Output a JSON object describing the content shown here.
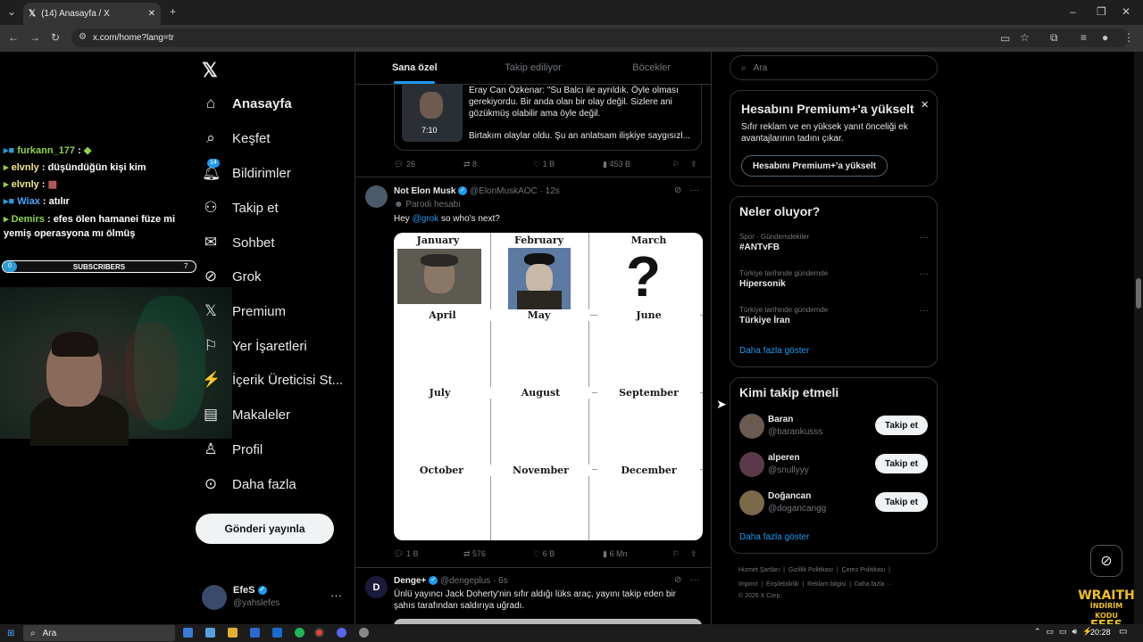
{
  "browser": {
    "tab_title": "(14) Anasayfa / X",
    "url": "x.com/home?lang=tr"
  },
  "stream": {
    "chat": [
      {
        "user": "furkann_177",
        "message": ""
      },
      {
        "user": "elvnly",
        "message": "düşündüğün kişi kim"
      },
      {
        "user": "elvnly",
        "message": ""
      },
      {
        "user": "Wiax",
        "message": "atılır"
      },
      {
        "user": "Demirs",
        "message": "efes ölen hamanei füze mi yemiş operasyona mı ölmüş"
      }
    ],
    "subscribers_label": "SUBSCRIBERS",
    "subscribers_count": "7",
    "subscribers_progress": "0",
    "overlay_text": [
      "WRAITH",
      "İNDİRİM KODU",
      "EFES"
    ]
  },
  "nav": {
    "items": [
      {
        "label": "Anasayfa",
        "icon": "home-icon",
        "badge": ""
      },
      {
        "label": "Keşfet",
        "icon": "search-icon",
        "badge": ""
      },
      {
        "label": "Bildirimler",
        "icon": "bell-icon",
        "badge": "14"
      },
      {
        "label": "Takip et",
        "icon": "follow-icon",
        "badge": ""
      },
      {
        "label": "Sohbet",
        "icon": "mail-icon",
        "badge": ""
      },
      {
        "label": "Grok",
        "icon": "grok-icon",
        "badge": ""
      },
      {
        "label": "Premium",
        "icon": "x-icon",
        "badge": ""
      },
      {
        "label": "Yer İşaretleri",
        "icon": "bookmark-icon",
        "badge": ""
      },
      {
        "label": "İçerik Üreticisi St...",
        "icon": "creator-icon",
        "badge": ""
      },
      {
        "label": "Makaleler",
        "icon": "article-icon",
        "badge": ""
      },
      {
        "label": "Profil",
        "icon": "person-icon",
        "badge": ""
      },
      {
        "label": "Daha fazla",
        "icon": "more-icon",
        "badge": ""
      }
    ],
    "post_button": "Gönderi yayınla",
    "account": {
      "name": "EfeS",
      "handle": "@yahslefes"
    }
  },
  "timeline": {
    "tabs": [
      "Sana özel",
      "Takip ediliyor",
      "Böcekler"
    ],
    "tweet1": {
      "video_duration": "7:10",
      "card_text": "Eray Can Özkenar: \"Su Balcı ile ayrıldık. Öyle olması gerekiyordu. Bir anda olan bir olay değil. Sizlere ani gözükmüş olabilir ama öyle değil.",
      "card_text2": "Birtakım olaylar oldu. Şu an anlatsam ilişkiye saygısızl...",
      "replies": "26",
      "retweets": "8",
      "likes": "1 B",
      "views": "453 B"
    },
    "tweet2": {
      "name": "Not Elon Musk",
      "handle": "@ElonMuskAOC",
      "time": "· 12s",
      "label": "Parodi hesabı",
      "text_prefix": "Hey",
      "mention": "@grok",
      "text_suffix": "so who's next?",
      "months": [
        "January",
        "February",
        "March",
        "April",
        "May",
        "June",
        "July",
        "August",
        "September",
        "October",
        "November",
        "December"
      ],
      "question_mark": "?",
      "replies": "1 B",
      "retweets": "576",
      "likes": "6 B",
      "views": "6 Mn"
    },
    "tweet3": {
      "name": "Denge+",
      "handle": "@dengeplus",
      "time": "· 6s",
      "text": "Ünlü yayıncı Jack Doherty'nin sıfır aldığı lüks araç, yayını takip eden bir şahıs tarafından saldırıya uğradı."
    }
  },
  "sidebar": {
    "search_placeholder": "Ara",
    "premium": {
      "title": "Hesabını Premium+'a yükselt",
      "text": "Sıfır reklam ve en yüksek yanıt önceliği ek avantajlarının tadını çıkar.",
      "button": "Hesabını Premium+'a yükselt"
    },
    "trends": {
      "title": "Neler oluyor?",
      "items": [
        {
          "context": "Spor · Gündemdekiler",
          "name": "#ANTvFB"
        },
        {
          "context": "Türkiye tarihinde gündemde",
          "name": "Hipersonik"
        },
        {
          "context": "Türkiye tarihinde gündemde",
          "name": "Türkiye İran"
        }
      ],
      "more": "Daha fazla göster"
    },
    "follow": {
      "title": "Kimi takip etmeli",
      "items": [
        {
          "name": "Baran",
          "handle": "@barankusss",
          "button": "Takip et"
        },
        {
          "name": "alperen",
          "handle": "@snullyyy",
          "button": "Takip et"
        },
        {
          "name": "Doğancan",
          "handle": "@dogancangg",
          "button": "Takip et"
        }
      ],
      "more": "Daha fazla göster"
    },
    "footer": {
      "line1": "Hizmet Şartları  |  Gizlilik Politikası  |  Çerez Politikası  |",
      "line2": "Imprint  |  Erişilebilirlik  |  Reklam bilgisi  |  Daha fazla ···",
      "line3": "© 2026 X Corp."
    }
  },
  "taskbar": {
    "search": "Ara",
    "clock": "20:28"
  }
}
